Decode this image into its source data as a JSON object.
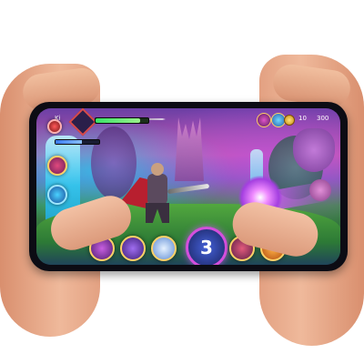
{
  "hud": {
    "player_level": "Ki",
    "gold_amount": "10",
    "score_text": "300",
    "ultimate_counter": "3",
    "hp_fraction": 0.85,
    "mp_fraction": 0.6
  },
  "icons": {
    "portrait": "hero-portrait-icon",
    "sword": "sword-icon",
    "coin": "coin-icon",
    "skill_1": "arcane-skill-icon",
    "skill_2": "shield-skill-icon",
    "skill_3": "ice-skill-icon",
    "skill_5": "dash-skill-icon",
    "skill_6": "fire-skill-icon"
  },
  "colors": {
    "accent": "#d44fdc",
    "hp": "#3ae36a",
    "mp": "#3a7bf0",
    "border_gold": "#ffd167"
  }
}
